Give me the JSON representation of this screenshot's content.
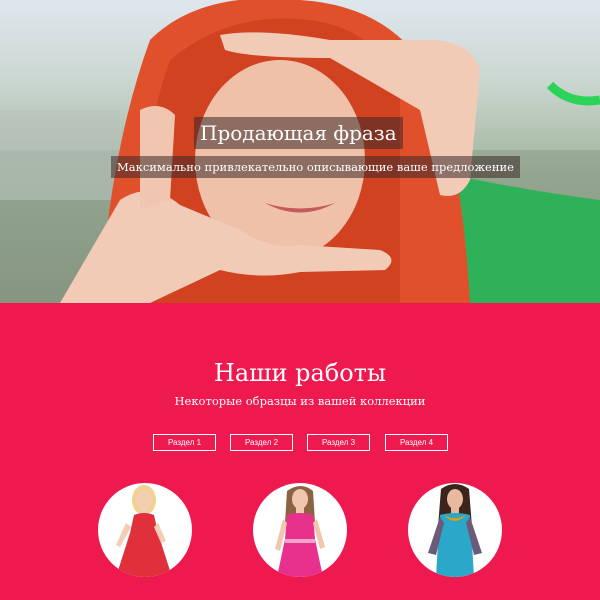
{
  "hero": {
    "headline": "Продающая фраза",
    "subline": "Максимально привлекательно описывающие ваше предложение"
  },
  "works": {
    "title": "Наши работы",
    "subtitle": "Некоторые образцы из вашей коллекции",
    "tabs": [
      "Раздел 1",
      "Раздел 2",
      "Раздел 3",
      "Раздел 4"
    ]
  },
  "colors": {
    "accent": "#ee1a4f",
    "text": "#ffffff"
  }
}
